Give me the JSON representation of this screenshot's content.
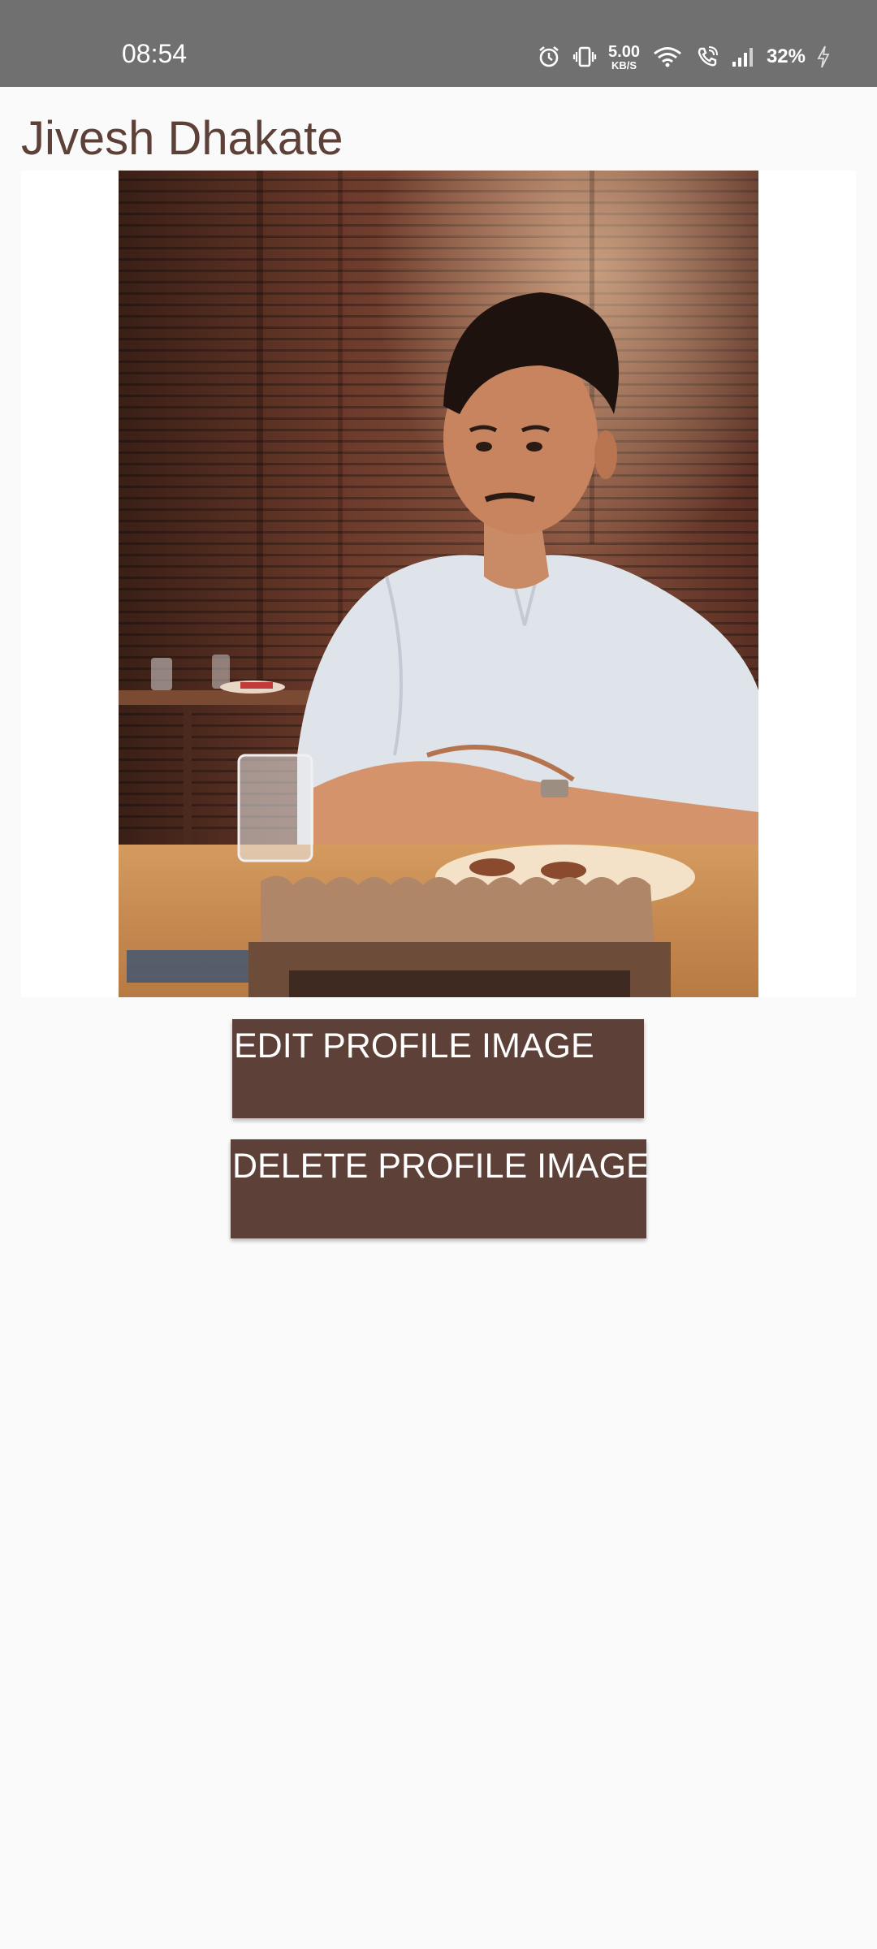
{
  "status_bar": {
    "time": "08:54",
    "net_speed_value": "5.00",
    "net_speed_unit": "KB/S",
    "battery": "32%",
    "icons": [
      "alarm-icon",
      "vibrate-icon",
      "wifi-icon",
      "wifi-calling-icon",
      "signal-icon",
      "charging-icon"
    ]
  },
  "profile": {
    "name": "Jivesh Dhakate",
    "image_description": "profile-photo"
  },
  "actions": {
    "edit_label": "EDIT PROFILE IMAGE",
    "delete_label": "DELETE PROFILE IMAGE"
  },
  "colors": {
    "status_bar": "#707070",
    "background": "#fafafa",
    "accent": "#5d4037",
    "button_text": "#ffffff"
  }
}
